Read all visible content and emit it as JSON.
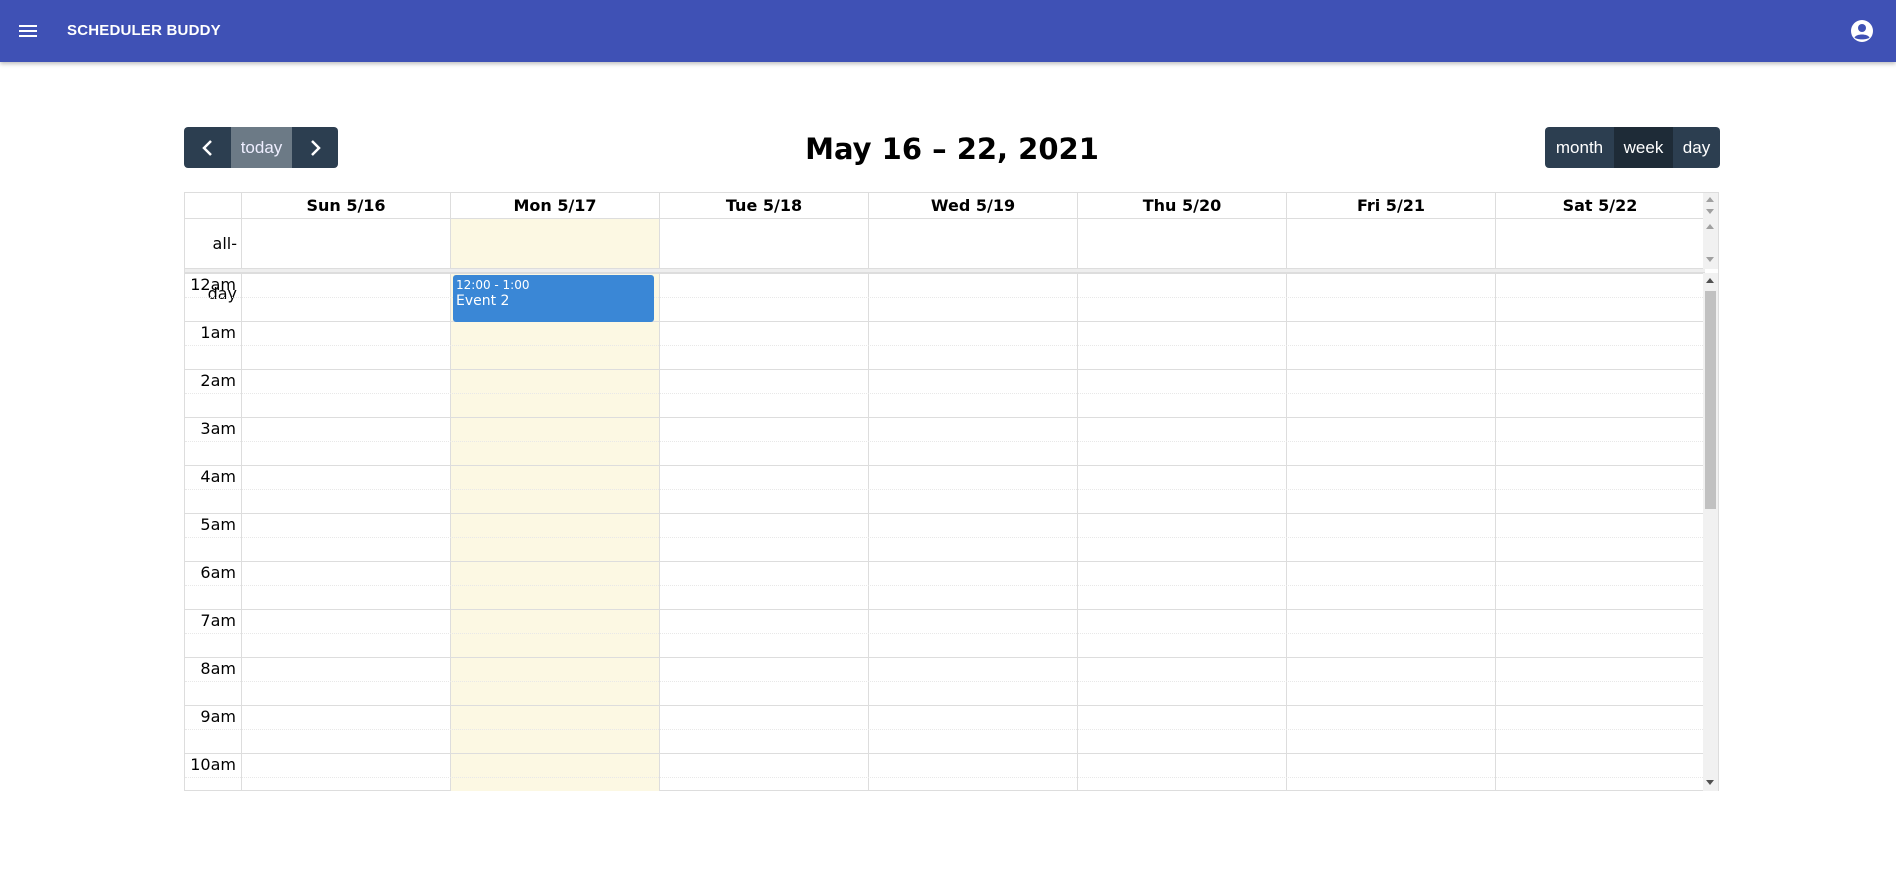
{
  "app": {
    "title": "SCHEDULER BUDDY",
    "menu_icon": "menu-icon",
    "account_icon": "account-circle-icon",
    "bar_color": "#3f51b5"
  },
  "toolbar": {
    "prev_icon": "chevron-left-icon",
    "today_label": "today",
    "next_icon": "chevron-right-icon",
    "title": "May 16 – 22, 2021",
    "views": [
      {
        "label": "month",
        "active": false
      },
      {
        "label": "week",
        "active": true
      },
      {
        "label": "day",
        "active": false
      }
    ]
  },
  "calendar": {
    "days": [
      "Sun 5/16",
      "Mon 5/17",
      "Tue 5/18",
      "Wed 5/19",
      "Thu 5/20",
      "Fri 5/21",
      "Sat 5/22"
    ],
    "today_index": 1,
    "allday_label": "all-day",
    "hours": [
      "12am",
      "1am",
      "2am",
      "3am",
      "4am",
      "5am",
      "6am",
      "7am",
      "8am",
      "9am",
      "10am"
    ],
    "events": [
      {
        "time": "12:00 - 1:00",
        "title": "Event 2",
        "day_index": 1,
        "color": "#3a87d6"
      }
    ],
    "today_color": "#fcf8e3"
  }
}
